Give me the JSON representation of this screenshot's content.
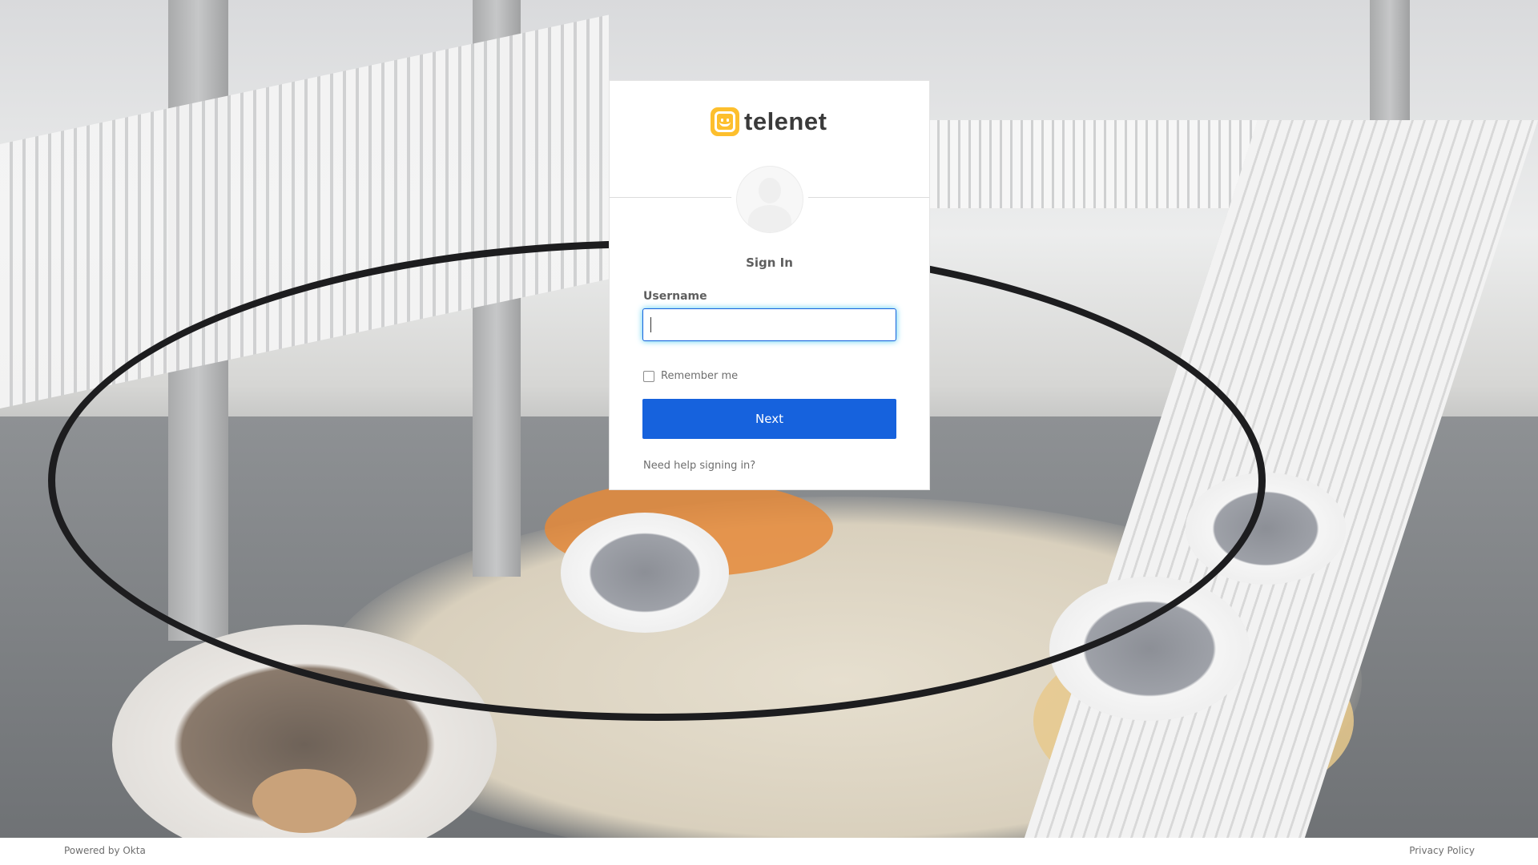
{
  "brand": {
    "logo_text": "telenet",
    "accent_color": "#fdbf2d",
    "primary_button_color": "#1662dd"
  },
  "card": {
    "title": "Sign In",
    "username_label": "Username",
    "username_value": "",
    "remember_label": "Remember me",
    "remember_checked": false,
    "next_label": "Next",
    "help_link": "Need help signing in?"
  },
  "footer": {
    "powered_by": "Powered by Okta",
    "privacy": "Privacy Policy"
  },
  "icons": {
    "logo": "telenet-smiley-logo-icon",
    "avatar": "user-avatar-icon"
  }
}
